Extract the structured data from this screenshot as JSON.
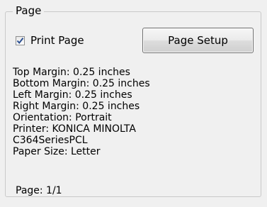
{
  "group": {
    "title": "Page"
  },
  "print_page": {
    "label": "Print Page",
    "checked": true
  },
  "page_setup_button": {
    "label": "Page Setup"
  },
  "info": {
    "top_margin": "Top Margin: 0.25 inches",
    "bottom_margin": "Bottom Margin: 0.25 inches",
    "left_margin": "Left Margin: 0.25 inches",
    "right_margin": "Right Margin: 0.25 inches",
    "orientation": "Orientation: Portrait",
    "printer_line1": "Printer: KONICA MINOLTA",
    "printer_line2": "C364SeriesPCL",
    "paper_size": "Paper Size: Letter"
  },
  "page_count": "Page: 1/1",
  "colors": {
    "background": "#f0f0f0",
    "check_mark": "#2b4f91"
  },
  "icons": {
    "checkbox": "check-mark-icon"
  }
}
